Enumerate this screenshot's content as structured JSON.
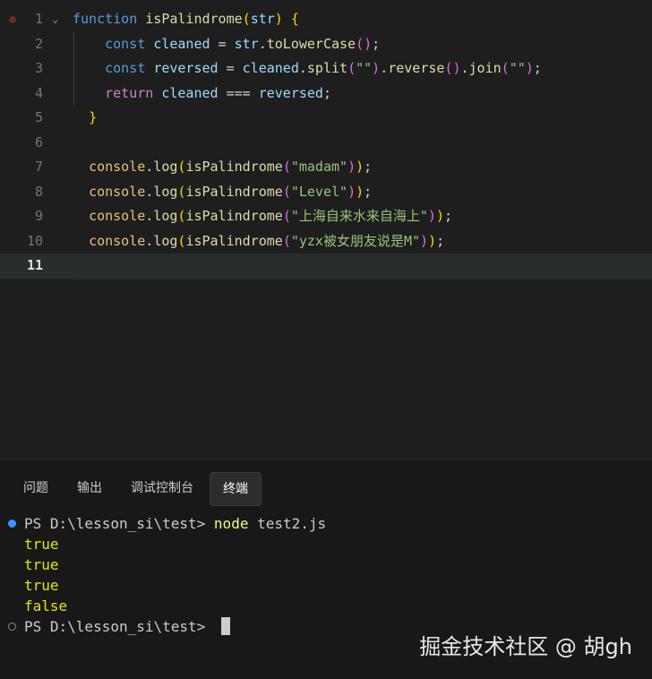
{
  "editor": {
    "lines": [
      {
        "n": "1",
        "tokens": [
          [
            "kw2",
            "function "
          ],
          [
            "fn",
            "isPalindrome"
          ],
          [
            "b1",
            "("
          ],
          [
            "var",
            "str"
          ],
          [
            "b1",
            ")"
          ],
          [
            "pun",
            " "
          ],
          [
            "b1",
            "{"
          ]
        ]
      },
      {
        "n": "2",
        "tokens": [
          [
            "pun",
            "    "
          ],
          [
            "kw2",
            "const "
          ],
          [
            "var",
            "cleaned"
          ],
          [
            "pun",
            " = "
          ],
          [
            "var",
            "str"
          ],
          [
            "pun",
            "."
          ],
          [
            "mth",
            "toLowerCase"
          ],
          [
            "b2",
            "()"
          ],
          [
            "pun",
            ";"
          ]
        ]
      },
      {
        "n": "3",
        "tokens": [
          [
            "pun",
            "    "
          ],
          [
            "kw2",
            "const "
          ],
          [
            "var",
            "reversed"
          ],
          [
            "pun",
            " = "
          ],
          [
            "var",
            "cleaned"
          ],
          [
            "pun",
            "."
          ],
          [
            "mth",
            "split"
          ],
          [
            "b2",
            "("
          ],
          [
            "str2",
            "\"\""
          ],
          [
            "b2",
            ")"
          ],
          [
            "pun",
            "."
          ],
          [
            "mth",
            "reverse"
          ],
          [
            "b2",
            "()"
          ],
          [
            "pun",
            "."
          ],
          [
            "mth",
            "join"
          ],
          [
            "b2",
            "("
          ],
          [
            "str2",
            "\"\""
          ],
          [
            "b2",
            ")"
          ],
          [
            "pun",
            ";"
          ]
        ]
      },
      {
        "n": "4",
        "tokens": [
          [
            "pun",
            "    "
          ],
          [
            "kw",
            "return "
          ],
          [
            "var",
            "cleaned"
          ],
          [
            "pun",
            " === "
          ],
          [
            "var",
            "reversed"
          ],
          [
            "pun",
            ";"
          ]
        ]
      },
      {
        "n": "5",
        "tokens": [
          [
            "pun",
            "  "
          ],
          [
            "b1",
            "}"
          ]
        ]
      },
      {
        "n": "6",
        "tokens": []
      },
      {
        "n": "7",
        "tokens": [
          [
            "pun",
            "  "
          ],
          [
            "obj",
            "console"
          ],
          [
            "pun",
            "."
          ],
          [
            "mth",
            "log"
          ],
          [
            "b1",
            "("
          ],
          [
            "fn",
            "isPalindrome"
          ],
          [
            "b2",
            "("
          ],
          [
            "str2",
            "\"madam\""
          ],
          [
            "b2",
            ")"
          ],
          [
            "b1",
            ")"
          ],
          [
            "pun",
            ";"
          ]
        ]
      },
      {
        "n": "8",
        "tokens": [
          [
            "pun",
            "  "
          ],
          [
            "obj",
            "console"
          ],
          [
            "pun",
            "."
          ],
          [
            "mth",
            "log"
          ],
          [
            "b1",
            "("
          ],
          [
            "fn",
            "isPalindrome"
          ],
          [
            "b2",
            "("
          ],
          [
            "str2",
            "\"Level\""
          ],
          [
            "b2",
            ")"
          ],
          [
            "b1",
            ")"
          ],
          [
            "pun",
            ";"
          ]
        ]
      },
      {
        "n": "9",
        "tokens": [
          [
            "pun",
            "  "
          ],
          [
            "obj",
            "console"
          ],
          [
            "pun",
            "."
          ],
          [
            "mth",
            "log"
          ],
          [
            "b1",
            "("
          ],
          [
            "fn",
            "isPalindrome"
          ],
          [
            "b2",
            "("
          ],
          [
            "str2",
            "\"上海自来水来自海上\""
          ],
          [
            "b2",
            ")"
          ],
          [
            "b1",
            ")"
          ],
          [
            "pun",
            ";"
          ]
        ]
      },
      {
        "n": "10",
        "tokens": [
          [
            "pun",
            "  "
          ],
          [
            "obj",
            "console"
          ],
          [
            "pun",
            "."
          ],
          [
            "mth",
            "log"
          ],
          [
            "b1",
            "("
          ],
          [
            "fn",
            "isPalindrome"
          ],
          [
            "b2",
            "("
          ],
          [
            "str2",
            "\"yzx被女朋友说是M\""
          ],
          [
            "b2",
            ")"
          ],
          [
            "b1",
            ")"
          ],
          [
            "pun",
            ";"
          ]
        ]
      },
      {
        "n": "11",
        "tokens": []
      }
    ]
  },
  "panel": {
    "tabs": [
      "问题",
      "输出",
      "调试控制台",
      "终端"
    ],
    "active_tab": "终端"
  },
  "terminal": {
    "lines": [
      {
        "dot": "blue",
        "prompt": "PS D:\\lesson_si\\test> ",
        "cmd": "node",
        "arg": " test2.js"
      },
      {
        "out": "true"
      },
      {
        "out": "true"
      },
      {
        "out": "true"
      },
      {
        "out": "false"
      },
      {
        "dot": "hollow",
        "prompt": "PS D:\\lesson_si\\test> ",
        "cursor": true
      }
    ]
  },
  "watermark": "掘金技术社区 @ 胡gh"
}
